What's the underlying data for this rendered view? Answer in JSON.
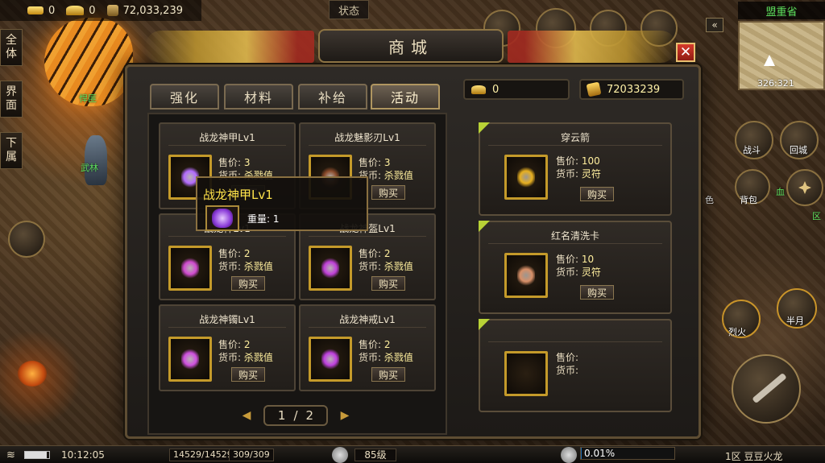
{
  "hud": {
    "coins": "0",
    "ingots": "0",
    "gold": "72,033,239",
    "status_tab": "状态"
  },
  "side_buttons": [
    "全体",
    "界面",
    "下属"
  ],
  "world_labels": {
    "npc1": "悍匪",
    "npc2": "武林"
  },
  "minimap": {
    "title": "盟重省",
    "coords": "326:321"
  },
  "right_skills": {
    "fight": "战斗",
    "return": "回城",
    "bag": "背包",
    "blood": "血",
    "zone": "区",
    "role": "色",
    "liehuo": "烈火",
    "banyue": "半月"
  },
  "shop": {
    "title": "商城",
    "close": "✕",
    "tabs": [
      "强化",
      "材料",
      "补给",
      "活动"
    ],
    "active_tab": 3,
    "currency": {
      "ingot_amount": "0",
      "token_amount": "72033239"
    },
    "price_label": "售价:",
    "currency_label": "货币:",
    "buy_label": "购买",
    "items": [
      {
        "name": "战龙神甲Lv1",
        "price": "3",
        "currency": "杀戮值",
        "color": "#b36cff"
      },
      {
        "name": "战龙魅影刃Lv1",
        "price": "3",
        "currency": "杀戮值",
        "color": "#8a4a2a"
      },
      {
        "name": "战龙神Lv1",
        "price": "2",
        "currency": "杀戮值",
        "color": "#d04ad0"
      },
      {
        "name": "战龙神盔Lv1",
        "price": "2",
        "currency": "杀戮值",
        "color": "#c040d8"
      },
      {
        "name": "战龙神镯Lv1",
        "price": "2",
        "currency": "杀戮值",
        "color": "#d050e0"
      },
      {
        "name": "战龙神戒Lv1",
        "price": "2",
        "currency": "杀戮值",
        "color": "#c040e0"
      }
    ],
    "pager": {
      "current": "1",
      "sep": "/",
      "total": "2"
    },
    "featured": [
      {
        "name": "穿云箭",
        "price": "100",
        "currency": "灵符",
        "color": "#e8b020",
        "buy": "购买"
      },
      {
        "name": "红名清洗卡",
        "price": "10",
        "currency": "灵符",
        "color": "#d89068",
        "buy": "购买"
      },
      {
        "name": "",
        "price": "",
        "currency": "",
        "color": "",
        "buy": ""
      }
    ],
    "tooltip": {
      "title": "战龙神甲Lv1",
      "weight": "重量: 1"
    }
  },
  "bottom": {
    "time": "10:12:05",
    "hp": "14529/14529",
    "mp": "309/309",
    "level": "85级",
    "exp": "0.01%",
    "exp_fraction": 0.0001,
    "server": "1区 豆豆火龙"
  },
  "colors": {
    "accent_gold": "#c49a2a",
    "value_yellow": "#ffef9e",
    "tooltip_title": "#ffe34a",
    "corner_green": "#b8d236"
  }
}
